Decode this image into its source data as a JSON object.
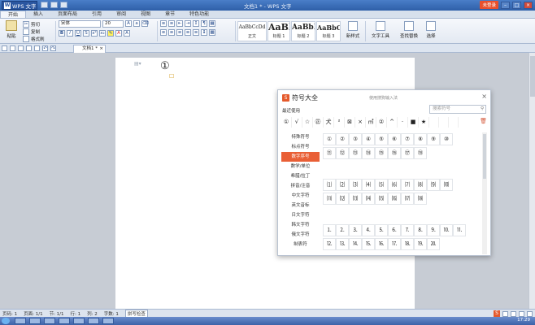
{
  "app": {
    "menu_label": "WPS 文字",
    "logo_letter": "W",
    "title": "文档1 * - WPS 文字",
    "login_label": "未登录"
  },
  "tabs": [
    "开始",
    "插入",
    "页面布局",
    "引用",
    "审阅",
    "视图",
    "章节",
    "特色功能"
  ],
  "ribbon": {
    "paste": "粘贴",
    "cut": "剪切",
    "copy": "复制",
    "format_painter": "格式刷",
    "font_name": "宋体",
    "font_size": "20",
    "styles": [
      {
        "sample": "AaBbCcDd",
        "label": "正文"
      },
      {
        "sample": "AaBl",
        "label": "标题 1"
      },
      {
        "sample": "AaBbI",
        "label": "标题 2"
      },
      {
        "sample": "AaBbC",
        "label": "标题 3"
      }
    ],
    "new_style": "新样式",
    "text_tools": "文字工具",
    "find_replace": "查找替换",
    "select": "选择"
  },
  "doc_tab": {
    "label": "文档1 *",
    "close": "×"
  },
  "page": {
    "circled_char": "①",
    "paste_mark": "☐"
  },
  "dialog": {
    "title": "符号大全",
    "logo": "S",
    "hint": "使用搜狗输入法",
    "close": "×",
    "recent_label": "最近使用",
    "search_placeholder": "搜索符号",
    "recent": [
      "①",
      "√",
      "☆",
      "㊣",
      "犬",
      "²",
      "⊠",
      "×",
      "㎡",
      "②",
      "^",
      "·",
      "■",
      "★"
    ],
    "categories": [
      "特殊符号",
      "标点符号",
      "数字序号",
      "数学/单位",
      "希腊/拉丁",
      "拼音/注音",
      "中文字符",
      "英文音标",
      "日文字符",
      "韩文字符",
      "俄文字符",
      "制表符"
    ],
    "active_category": "数字序号",
    "rows": [
      [
        "①",
        "②",
        "③",
        "④",
        "⑤",
        "⑥",
        "⑦",
        "⑧",
        "⑨",
        "⑩"
      ],
      [
        "⑪",
        "⑫",
        "⑬",
        "⑭",
        "⑮",
        "⑯",
        "⑰",
        "⑱"
      ],
      [
        "⑴",
        "⑵",
        "⑶",
        "⑷",
        "⑸",
        "⑹",
        "⑺",
        "⑻",
        "⑼",
        "⑽"
      ],
      [
        "⑾",
        "⑿",
        "⒀",
        "⒁",
        "⒂",
        "⒃",
        "⒄",
        "⒅"
      ],
      [
        "⒈",
        "⒉",
        "⒊",
        "⒋",
        "⒌",
        "⒍",
        "⒎",
        "⒏",
        "⒐",
        "⒑",
        "⒒"
      ],
      [
        "⒓",
        "⒔",
        "⒕",
        "⒖",
        "⒗",
        "⒘",
        "⒙",
        "⒚",
        "⒛"
      ]
    ]
  },
  "status": {
    "pages": "页码: 1",
    "page_of": "页面: 1/1",
    "section": "节: 1/1",
    "row": "行: 1",
    "col": "列: 2",
    "words": "字数: 1",
    "mode": "拼写检查"
  },
  "taskbar": {
    "clock": "17:29"
  }
}
